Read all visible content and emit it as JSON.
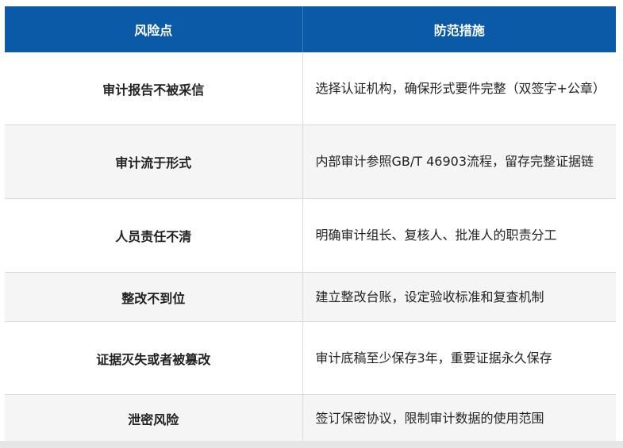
{
  "table": {
    "headers": [
      "风险点",
      "防范措施"
    ],
    "rows": [
      {
        "risk": "审计报告不被采信",
        "measure": "选择认证机构，确保形式要件完整（双签字+公章）"
      },
      {
        "risk": "审计流于形式",
        "measure": "内部审计参照GB/T 46903流程，留存完整证据链"
      },
      {
        "risk": "人员责任不清",
        "measure": "明确审计组长、复核人、批准人的职责分工"
      },
      {
        "risk": "整改不到位",
        "measure": "建立整改台账，设定验收标准和复查机制"
      },
      {
        "risk": "证据灭失或者被篡改",
        "measure": "审计底稿至少保存3年，重要证据永久保存"
      },
      {
        "risk": "泄密风险",
        "measure": "签订保密协议，限制审计数据的使用范围"
      }
    ]
  },
  "colors": {
    "header_bg": "#0a5aa8",
    "header_text": "#ffffff",
    "row_alt_bg": "#f5f5f5",
    "border": "#dcdcdc"
  }
}
